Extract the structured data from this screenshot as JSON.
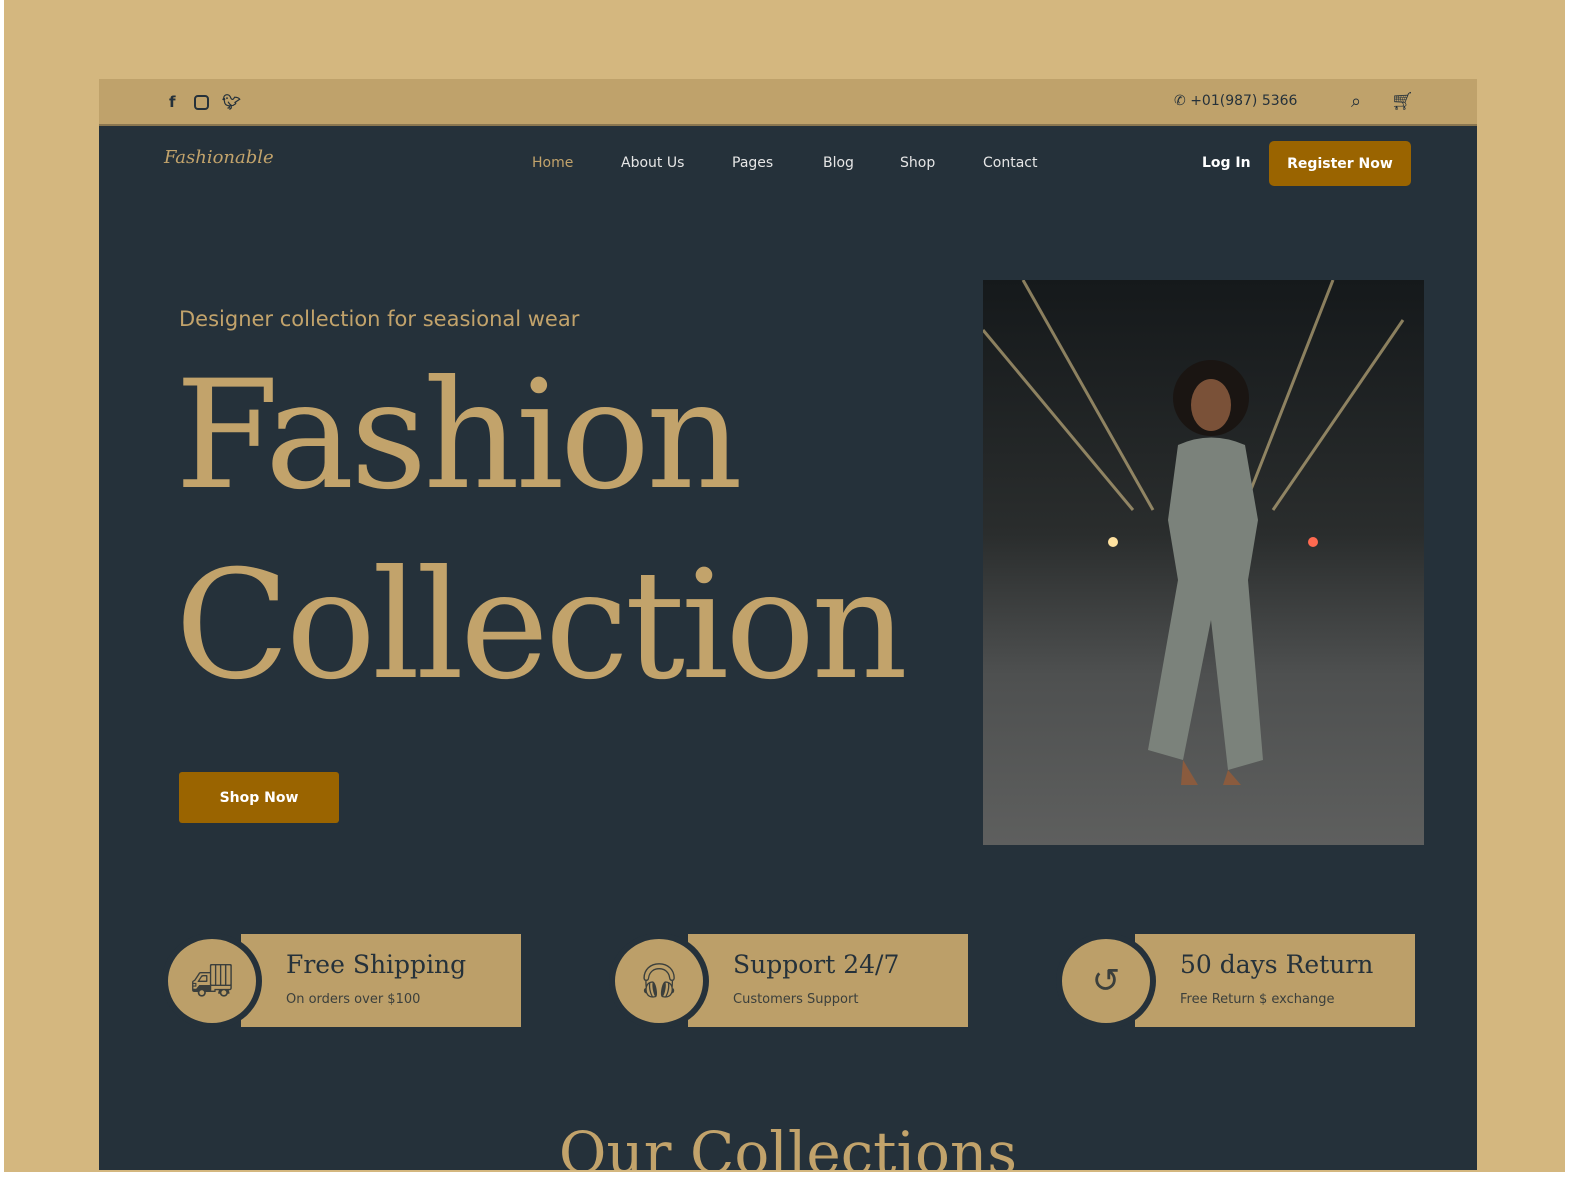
{
  "topbar": {
    "phone": "+01(987) 5366",
    "social": [
      "facebook-icon",
      "instagram-icon",
      "twitter-icon"
    ]
  },
  "nav": {
    "logo": "Fashionable",
    "items": [
      "Home",
      "About Us",
      "Pages",
      "Blog",
      "Shop",
      "Contact"
    ],
    "login": "Log In",
    "register": "Register Now"
  },
  "hero": {
    "subtitle": "Designer collection for seasional wear",
    "line1": "Fashion",
    "line2": "Collection",
    "cta": "Shop Now"
  },
  "features": [
    {
      "title": "Free Shipping",
      "sub": "On orders over $100",
      "icon": "truck-icon"
    },
    {
      "title": "Support 24/7",
      "sub": "Customers Support",
      "icon": "headset-icon"
    },
    {
      "title": "50 days Return",
      "sub": "Free Return $ exchange",
      "icon": "return-icon"
    }
  ],
  "section_title": "Our Collections",
  "colors": {
    "gold": "#c2a36b",
    "dark": "#25313a",
    "button": "#9a6400",
    "topbar": "#bfa26b"
  }
}
